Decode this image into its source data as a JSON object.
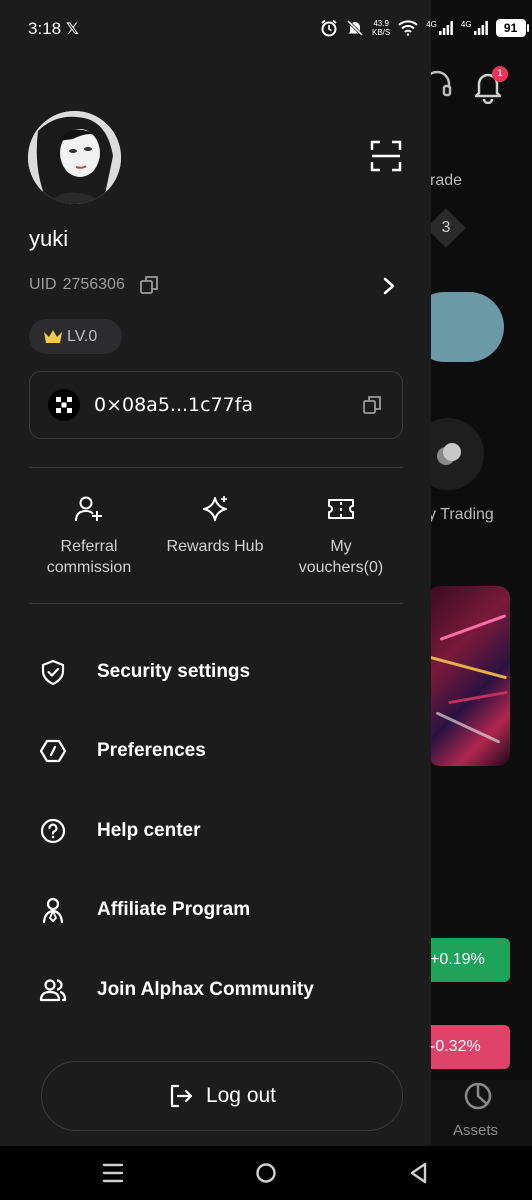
{
  "status_bar": {
    "time": "3:18",
    "x_glyph": "𝕏",
    "net_speed_top": "43.9",
    "net_speed_bottom": "KB/S",
    "net_type_1": "4G",
    "net_type_2": "4G",
    "battery": "91"
  },
  "background_app": {
    "bell_badge": "1",
    "trade_partial": "rade",
    "diamond_number": "3",
    "trading_partial": "y Trading",
    "green_change": "+0.19%",
    "red_change": "-0.32%",
    "assets_tab": "Assets"
  },
  "profile": {
    "username": "yuki",
    "uid_label": "UID",
    "uid_value": "2756306",
    "level": "LV.0",
    "wallet_address": "0×08a5...1c77fa"
  },
  "quick_actions": [
    {
      "label_line1": "Referral",
      "label_line2": "commission",
      "icon": "add-user-icon"
    },
    {
      "label_line1": "Rewards Hub",
      "label_line2": "",
      "icon": "sparkle-icon"
    },
    {
      "label_line1": "My",
      "label_line2": "vouchers(0)",
      "icon": "ticket-icon"
    }
  ],
  "menu": [
    {
      "label": "Security settings",
      "icon": "shield-check-icon"
    },
    {
      "label": "Preferences",
      "icon": "hexagon-icon"
    },
    {
      "label": "Help center",
      "icon": "question-circle-icon"
    },
    {
      "label": "Affiliate Program",
      "icon": "person-ribbon-icon"
    },
    {
      "label": "Join Alphax Community",
      "icon": "community-icon"
    }
  ],
  "logout_label": "Log out",
  "colors": {
    "drawer_bg": "#1c1c1d",
    "border": "#3a3a3c",
    "crown": "#f2c94c",
    "positive": "#1fa35a",
    "negative": "#e0436a"
  }
}
